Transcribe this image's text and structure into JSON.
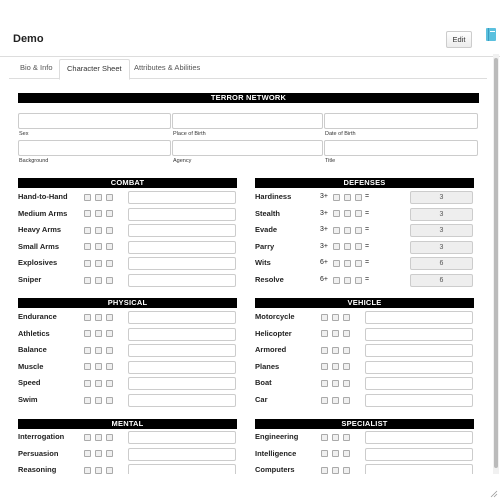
{
  "app": {
    "title": "Demo",
    "edit_label": "Edit"
  },
  "tabs": [
    "Bio & Info",
    "Character Sheet",
    "Attributes & Abilities"
  ],
  "network": {
    "title": "TERROR NETWORK",
    "fields_row1": [
      "Sex",
      "Place of Birth",
      "Date of Birth"
    ],
    "fields_row2": [
      "Background",
      "Agency",
      "Title"
    ]
  },
  "sections": {
    "combat": {
      "title": "COMBAT",
      "items": [
        "Hand-to-Hand",
        "Medium Arms",
        "Heavy Arms",
        "Small Arms",
        "Explosives",
        "Sniper"
      ]
    },
    "defenses": {
      "title": "DEFENSES",
      "items": [
        {
          "name": "Hardiness",
          "threshold": "3+",
          "eq": "=",
          "value": "3"
        },
        {
          "name": "Stealth",
          "threshold": "3+",
          "eq": "=",
          "value": "3"
        },
        {
          "name": "Evade",
          "threshold": "3+",
          "eq": "=",
          "value": "3"
        },
        {
          "name": "Parry",
          "threshold": "3+",
          "eq": "=",
          "value": "3"
        },
        {
          "name": "Wits",
          "threshold": "6+",
          "eq": "=",
          "value": "6"
        },
        {
          "name": "Resolve",
          "threshold": "6+",
          "eq": "=",
          "value": "6"
        }
      ]
    },
    "physical": {
      "title": "PHYSICAL",
      "items": [
        "Endurance",
        "Athletics",
        "Balance",
        "Muscle",
        "Speed",
        "Swim"
      ]
    },
    "vehicle": {
      "title": "VEHICLE",
      "items": [
        "Motorcycle",
        "Helicopter",
        "Armored",
        "Planes",
        "Boat",
        "Car"
      ]
    },
    "mental": {
      "title": "MENTAL",
      "items": [
        "Interrogation",
        "Persuasion",
        "Reasoning"
      ]
    },
    "specialist": {
      "title": "SPECIALIST",
      "items": [
        "Engineering",
        "Intelligence",
        "Computers"
      ]
    }
  },
  "colors": {
    "bar": "#000000",
    "border": "#cccccc",
    "disabled_field": "#eeeeee"
  },
  "icons": {
    "book": "book-icon",
    "resize": "resize-handle-icon"
  }
}
